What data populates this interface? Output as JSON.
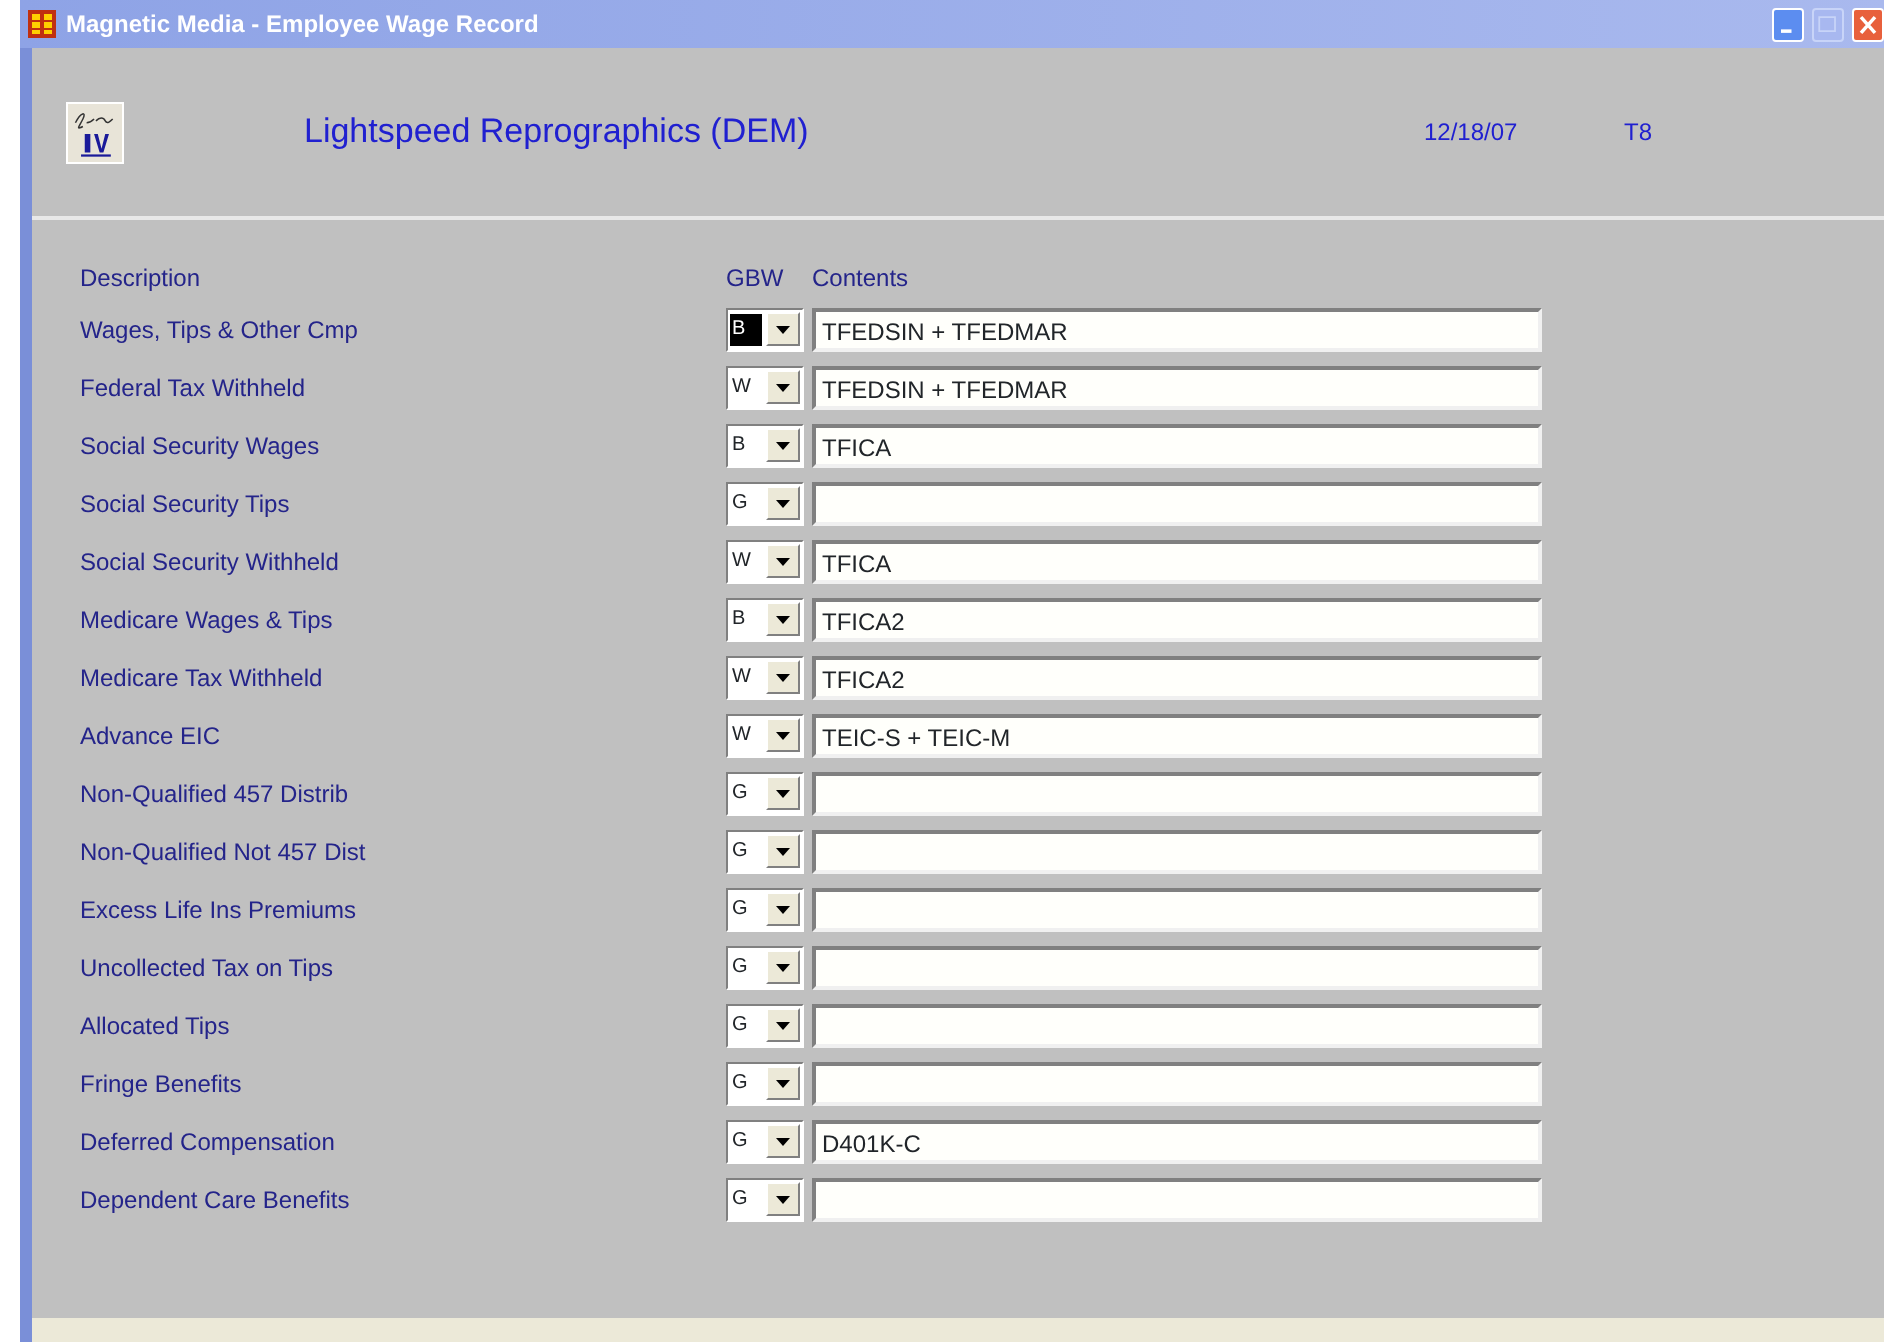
{
  "window": {
    "title": "Magnetic Media - Employee Wage Record"
  },
  "header": {
    "company": "Lightspeed Reprographics (DEM)",
    "date": "12/18/07",
    "terminal": "T8"
  },
  "columns": {
    "description": "Description",
    "gbw": "GBW",
    "contents": "Contents"
  },
  "rows": [
    {
      "description": "Wages, Tips & Other Cmp",
      "gbw": "B",
      "contents": "TFEDSIN + TFEDMAR",
      "selected": true
    },
    {
      "description": "Federal Tax Withheld",
      "gbw": "W",
      "contents": "TFEDSIN + TFEDMAR",
      "selected": false
    },
    {
      "description": "Social Security Wages",
      "gbw": "B",
      "contents": "TFICA",
      "selected": false
    },
    {
      "description": "Social Security Tips",
      "gbw": "G",
      "contents": "",
      "selected": false
    },
    {
      "description": "Social Security Withheld",
      "gbw": "W",
      "contents": "TFICA",
      "selected": false
    },
    {
      "description": "Medicare Wages & Tips",
      "gbw": "B",
      "contents": "TFICA2",
      "selected": false
    },
    {
      "description": "Medicare Tax Withheld",
      "gbw": "W",
      "contents": "TFICA2",
      "selected": false
    },
    {
      "description": "Advance EIC",
      "gbw": "W",
      "contents": "TEIC-S + TEIC-M",
      "selected": false
    },
    {
      "description": "Non-Qualified 457 Distrib",
      "gbw": "G",
      "contents": "",
      "selected": false
    },
    {
      "description": "Non-Qualified Not 457 Dist",
      "gbw": "G",
      "contents": "",
      "selected": false
    },
    {
      "description": "Excess Life Ins Premiums",
      "gbw": "G",
      "contents": "",
      "selected": false
    },
    {
      "description": "Uncollected Tax on Tips",
      "gbw": "G",
      "contents": "",
      "selected": false
    },
    {
      "description": "Allocated Tips",
      "gbw": "G",
      "contents": "",
      "selected": false
    },
    {
      "description": "Fringe Benefits",
      "gbw": "G",
      "contents": "",
      "selected": false
    },
    {
      "description": "Deferred Compensation",
      "gbw": "G",
      "contents": "D401K-C",
      "selected": false
    },
    {
      "description": "Dependent Care Benefits",
      "gbw": "G",
      "contents": "",
      "selected": false
    }
  ]
}
